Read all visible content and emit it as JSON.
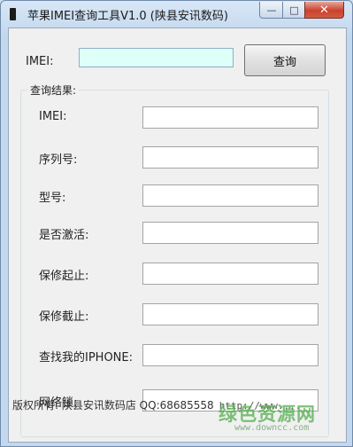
{
  "window": {
    "title": "苹果IMEI查询工具V1.0 (陕县安讯数码)",
    "minimize_glyph": "—",
    "maximize_glyph": "□",
    "close_glyph": "✕"
  },
  "form": {
    "imei_label": "IMEI:",
    "imei_value": "",
    "query_button": "查询",
    "results_group_label": "查询结果:",
    "fields": [
      {
        "label": "IMEI:",
        "value": ""
      },
      {
        "label": "序列号:",
        "value": ""
      },
      {
        "label": "型号:",
        "value": ""
      },
      {
        "label": "是否激活:",
        "value": ""
      },
      {
        "label": "保修起止:",
        "value": ""
      },
      {
        "label": "保修截止:",
        "value": ""
      },
      {
        "label": "查找我的IPHONE:",
        "value": ""
      },
      {
        "label": "网络锁:",
        "value": ""
      }
    ]
  },
  "footer": {
    "copyright": "版权所有: 陕县安讯数码店 QQ:68685558",
    "url": "http://www.... "
  },
  "watermark": {
    "text": "绿色资源网",
    "url": "www.downcc.com"
  },
  "colors": {
    "imei_input_bg": "#dffff9",
    "close_button": "#c9422d",
    "watermark": "#4caa46"
  }
}
